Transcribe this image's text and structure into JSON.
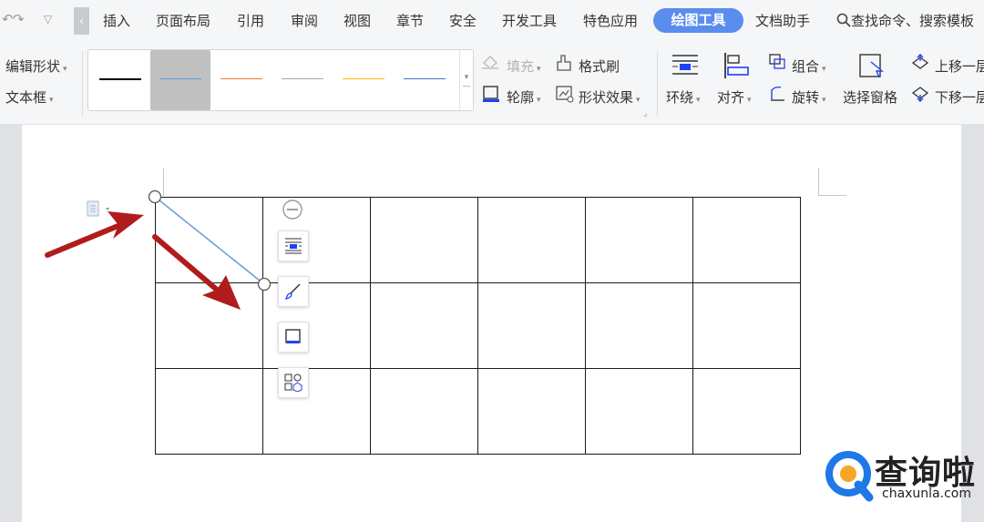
{
  "menubar": {
    "tabs": [
      "插入",
      "页面布局",
      "引用",
      "审阅",
      "视图",
      "章节",
      "安全",
      "开发工具",
      "特色应用"
    ],
    "active_tab": "绘图工具",
    "doc_helper": "文档助手",
    "search": "查找命令、搜索模板",
    "icons": [
      "undo-icon",
      "redo-icon",
      "customize-icon",
      "scroll-left-icon"
    ]
  },
  "ribbon": {
    "edit_shape": "编辑形状",
    "text_box": "文本框",
    "fill": "填充",
    "outline": "轮廓",
    "format_painter": "格式刷",
    "shape_effects": "形状效果",
    "wrap": "环绕",
    "align": "对齐",
    "group": "组合",
    "rotate": "旋转",
    "selection_pane": "选择窗格",
    "bring_forward": "上移一层",
    "send_backward": "下移一层",
    "line_styles": [
      {
        "color": "#000000"
      },
      {
        "color": "#5b9bd5"
      },
      {
        "color": "#ed7d31"
      },
      {
        "color": "#a5a5a5"
      },
      {
        "color": "#ffc000"
      },
      {
        "color": "#4472c4"
      }
    ]
  },
  "colors": {
    "accent": "#5b8def",
    "arrow": "#b01c1c",
    "line": "#6fa0d8"
  },
  "watermark": {
    "brand": "查询啦",
    "url": "chaxunla.com"
  }
}
